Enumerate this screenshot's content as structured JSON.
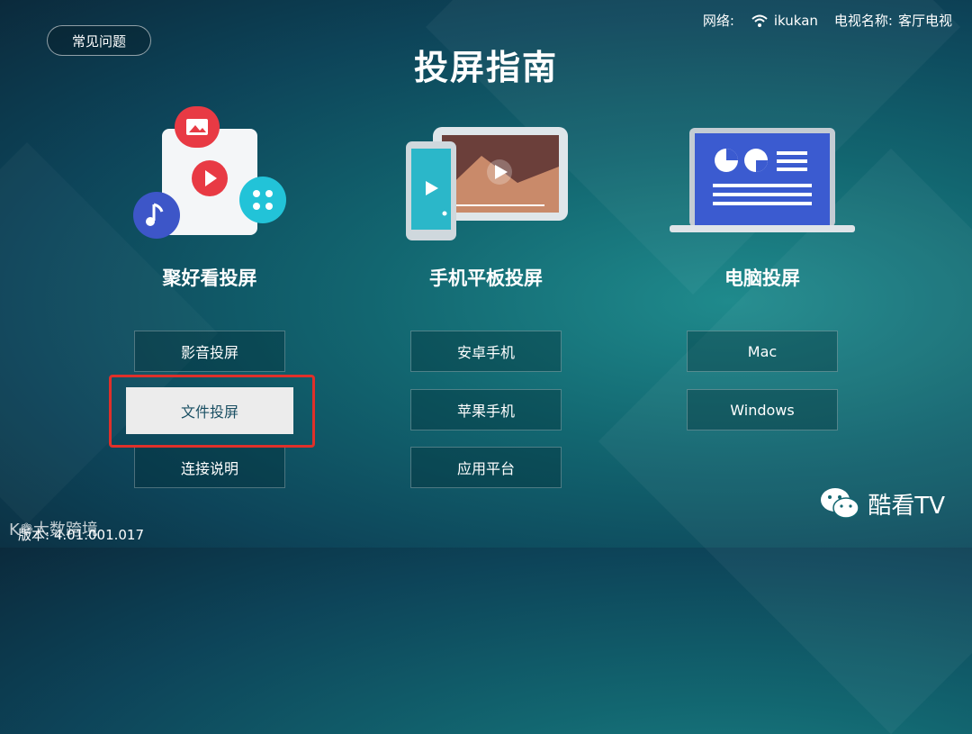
{
  "faq_label": "常见问题",
  "status": {
    "network_label": "网络:",
    "network_name": "ikukan",
    "tv_name_label": "电视名称:",
    "tv_name": "客厅电视"
  },
  "page_title": "投屏指南",
  "columns": [
    {
      "title": "聚好看投屏",
      "options": [
        "影音投屏",
        "文件投屏",
        "连接说明"
      ],
      "focused": "文件投屏"
    },
    {
      "title": "手机平板投屏",
      "options": [
        "安卓手机",
        "苹果手机",
        "应用平台"
      ]
    },
    {
      "title": "电脑投屏",
      "options": [
        "Mac",
        "Windows"
      ]
    }
  ],
  "version_text": "版本: 4.01.001.017",
  "watermark_text": "K❁大数跨境",
  "brand_text": "酷看TV",
  "colors": {
    "highlight": "#e0302a",
    "focused_bg": "#ececec",
    "background": "#126670"
  }
}
